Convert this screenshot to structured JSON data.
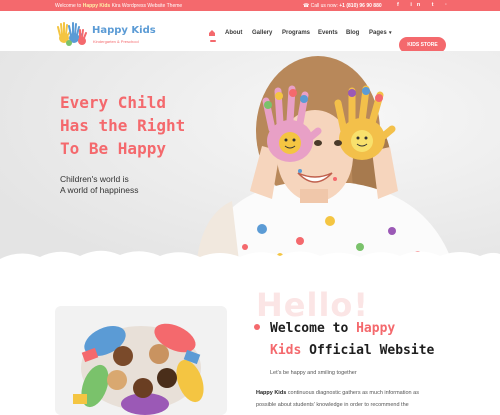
{
  "topbar": {
    "welcome_prefix": "Welcome to",
    "welcome_brand": "Happy Kids",
    "welcome_suffix": "Kira Wordpress Website Theme",
    "call_label": "Call us now:",
    "phone": "+1 (810) 96 90 880",
    "social": [
      "f",
      "in",
      "t",
      "·"
    ]
  },
  "brand": {
    "title": "Happy Kids",
    "subtitle": "Kindergarten & Preschool",
    "colors": {
      "accent": "#f4696d",
      "blue": "#5b9bd5"
    }
  },
  "nav": {
    "home_icon": "home-icon",
    "items": [
      "About",
      "Gallery",
      "Programs",
      "Events",
      "Blog",
      "Pages"
    ],
    "dropdown_icon": "chevron-down-icon",
    "store_button": "KIDS STORE"
  },
  "hero": {
    "headline": [
      "Every Child",
      "Has the Right",
      "To Be Happy"
    ],
    "subtext": [
      "Children's world is",
      "A world of happiness"
    ]
  },
  "intro": {
    "bg_word": "Hello!",
    "heading_a": "Welcome to ",
    "heading_b": "Happy",
    "heading_c": "Kids",
    "heading_d": " Official Website",
    "tagline": "Let's be happy and smiling together",
    "body_brand": "Happy Kids",
    "body_text_1": " continuous diagnostic gathers as much information as",
    "body_text_2": "possible about students' knowledge in order to recommend the"
  }
}
